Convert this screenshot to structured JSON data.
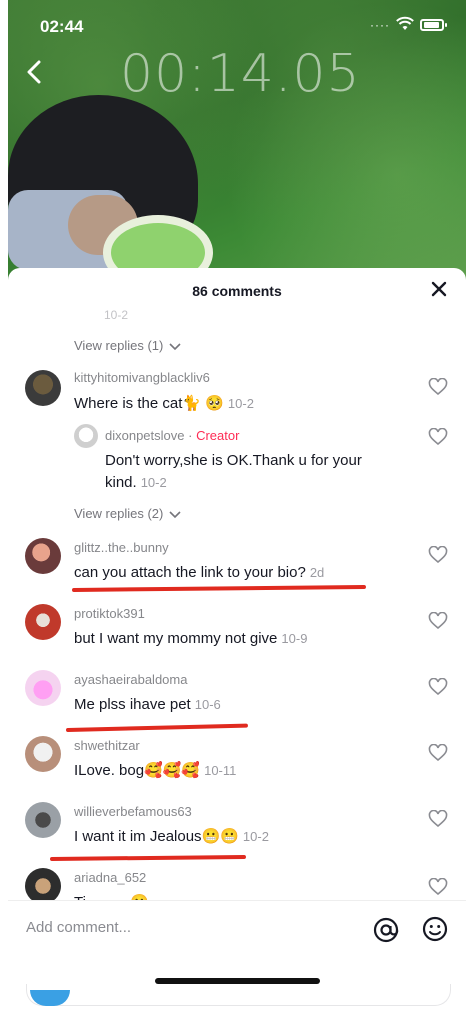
{
  "status_bar": {
    "time": "02:44"
  },
  "video": {
    "timer": "00:14.05"
  },
  "sheet": {
    "title": "86 comments",
    "faded_date": "10-2"
  },
  "view_replies_1": "View replies (1)",
  "view_replies_2": "View replies (2)",
  "comments": [
    {
      "username": "kittyhitomivangblackliv6",
      "text": "Where is the cat🐈 🥺",
      "date": "10-2"
    },
    {
      "username": "dixonpetslove",
      "badge": "Creator",
      "separator": " · ",
      "text_line1": "Don't worry,she is OK.Thank u for your",
      "text_line2": "kind.",
      "date": "10-2"
    },
    {
      "username": "glittz..the..bunny",
      "text": "can you attach the link to your bio?",
      "date": "2d"
    },
    {
      "username": "protiktok391",
      "text": "but I want my mommy not give",
      "date": "10-9"
    },
    {
      "username": "ayashaeirabaldoma",
      "text": "Me plss ihave pet",
      "date": "10-6"
    },
    {
      "username": "shwethitzar",
      "text": "ILove. bog🥰🥰🥰",
      "date": "10-11"
    },
    {
      "username": "willieverbefamous63",
      "text": "I want it im Jealous😬😬",
      "date": "10-2"
    },
    {
      "username": "ariadna_652",
      "text": "Ti···· ····🙂",
      "date": ""
    }
  ],
  "input": {
    "placeholder": "Add comment..."
  },
  "colors": {
    "accent": "#fe2c55",
    "underline": "#e02a1f"
  }
}
